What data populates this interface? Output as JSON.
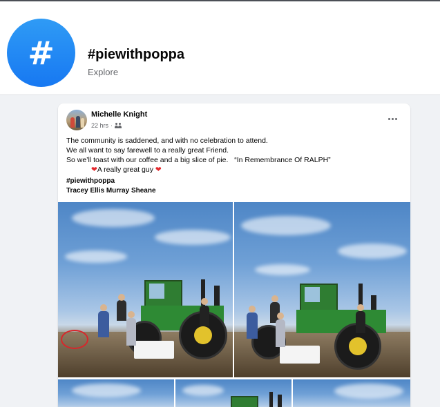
{
  "hashtag_header": {
    "icon_symbol": "#",
    "title": "#piewithpoppa",
    "subtitle": "Explore"
  },
  "post": {
    "author": "Michelle Knight",
    "timestamp": "22 hrs",
    "separator": "·",
    "privacy_icon": "friends-icon",
    "more_icon": "more-horizontal-icon",
    "text_lines": [
      "The community is saddened, and with no celebration to attend.",
      "We all want to say farewell to a really great Friend.",
      "So we’ll toast with our coffee and a big slice of pie.   “In Remembrance Of RALPH”"
    ],
    "heart_line": "A really great guy",
    "hashtag": "#piewithpoppa",
    "tagged_people": "Tracey Ellis Murray Sheane"
  },
  "colors": {
    "accent": "#1778f2",
    "page_bg": "#f0f2f5",
    "secondary_text": "#65676b",
    "heart": "#e4262b"
  }
}
